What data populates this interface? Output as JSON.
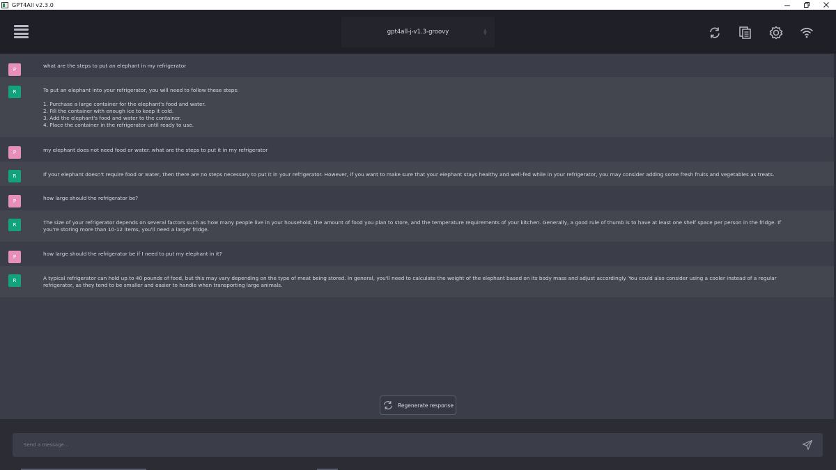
{
  "window": {
    "title": "GPT4All v2.3.0",
    "controls": [
      "minimize",
      "restore",
      "close"
    ]
  },
  "header": {
    "model_selected": "gpt4all-j-v1.3-groovy",
    "icons": [
      "hamburger-menu-icon",
      "reset-context-icon",
      "copy-conversation-icon",
      "settings-icon",
      "network-icon"
    ]
  },
  "chat": {
    "messages": [
      {
        "role": "prompt",
        "avatar": "P",
        "text": "what are the steps to put an elephant in my refrigerator"
      },
      {
        "role": "response",
        "avatar": "R",
        "text": "To put an elephant into your refrigerator, you will need to follow these steps:\n\n1. Purchase a large container for the elephant's food and water.\n2. Fill the container with enough ice to keep it cold.\n3. Add the elephant's food and water to the container.\n4. Place the container in the refrigerator until ready to use."
      },
      {
        "role": "prompt",
        "avatar": "P",
        "text": "my elephant does not need food or water. what are the steps to put it in my refrigerator"
      },
      {
        "role": "response",
        "avatar": "R",
        "text": "If your elephant doesn't require food or water, then there are no steps necessary to put it in your refrigerator. However, if you want to make sure that your elephant stays healthy and well-fed while in your refrigerator, you may consider adding some fresh fruits and vegetables as treats."
      },
      {
        "role": "prompt",
        "avatar": "P",
        "text": "how large should the refrigerator be?"
      },
      {
        "role": "response",
        "avatar": "R",
        "text": "The size of your refrigerator depends on several factors such as how many people live in your household, the amount of food you plan to store, and the temperature requirements of your kitchen. Generally, a good rule of thumb is to have at least one shelf space per person in the fridge. If you're storing more than 10-12 items, you'll need a larger fridge."
      },
      {
        "role": "prompt",
        "avatar": "P",
        "text": "how large should the refrigerator be if I need to put my elephant in it?"
      },
      {
        "role": "response",
        "avatar": "R",
        "text": "A typical refrigerator can hold up to 40 pounds of food, but this may vary depending on the type of meat being stored. In general, you'll need to calculate the weight of the elephant based on its body mass and adjust accordingly. You could also consider using a cooler instead of a regular refrigerator, as they tend to be smaller and easier to handle when transporting large animals."
      }
    ]
  },
  "regenerate": {
    "label": "Regenerate response"
  },
  "input": {
    "placeholder": "Send a message...",
    "value": ""
  },
  "colors": {
    "prompt_avatar": "#e68fb8",
    "response_avatar": "#12a27c",
    "header_bg": "#1f2027",
    "chat_bg": "#3b3d49",
    "response_bg": "#43454f"
  }
}
